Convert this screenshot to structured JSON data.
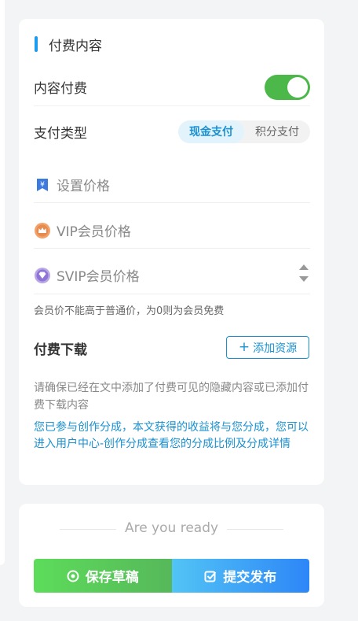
{
  "pay_card": {
    "title": "付费内容",
    "content_paid": {
      "label": "内容付费",
      "enabled": true
    },
    "pay_type": {
      "label": "支付类型",
      "options": [
        "现金支付",
        "积分支付"
      ],
      "selected": "现金支付"
    },
    "prices": {
      "normal_placeholder": "设置价格",
      "vip_placeholder": "VIP会员价格",
      "svip_placeholder": "SVIP会员价格"
    },
    "member_hint": "会员价不能高于普通价，为0则为会员免费",
    "download": {
      "title": "付费下载",
      "add_button": "添加资源"
    },
    "note_gray": "请确保已经在文中添加了付费可见的隐藏内容或已添加付费下载内容",
    "note_blue": "您已参与创作分成，本文获得的收益将与您分成，您可以进入用户中心-创作分成查看您的分成比例及分成详情"
  },
  "ready_card": {
    "text": "Are you ready",
    "save_draft": "保存草稿",
    "publish": "提交发布"
  },
  "colors": {
    "accent_blue": "#1a91d0",
    "toggle_green": "#4cb84a",
    "draft_green": "#5ddc5a",
    "publish_blue": "#2d86f7"
  },
  "icons": [
    "yen-tag-icon",
    "crown-medal-icon",
    "diamond-medal-icon",
    "plus-icon",
    "record-circle-icon",
    "check-square-icon",
    "spinner-up-icon",
    "spinner-down-icon"
  ]
}
